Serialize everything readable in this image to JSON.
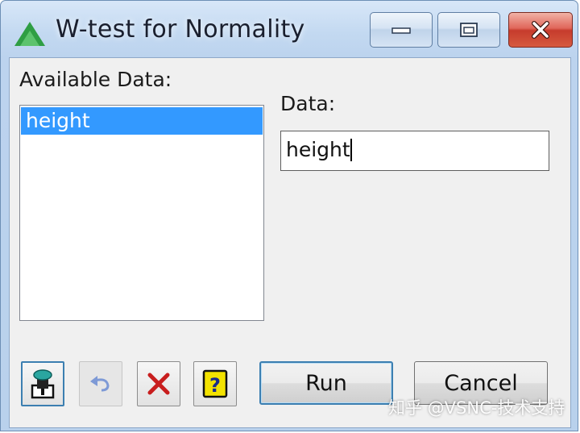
{
  "window": {
    "title": "W-test for Normality"
  },
  "titlebar": {
    "minimize_icon": "minimize-icon",
    "maximize_icon": "maximize-icon",
    "close_icon": "close-icon"
  },
  "available": {
    "label": "Available Data:",
    "items": [
      "height"
    ],
    "selected_index": 0
  },
  "data_field": {
    "label": "Data:",
    "value": "height"
  },
  "toolbar": {
    "icons": [
      "pin-icon",
      "undo-icon",
      "clear-icon",
      "help-icon"
    ],
    "help_glyph": "?"
  },
  "buttons": {
    "run": "Run",
    "cancel": "Cancel"
  },
  "watermark": "知乎 @VSNC-技术支持",
  "colors": {
    "selection": "#3399ff",
    "close_button": "#c63b2c",
    "clear_icon": "#c81e1e",
    "help_icon": "#f3e200"
  }
}
